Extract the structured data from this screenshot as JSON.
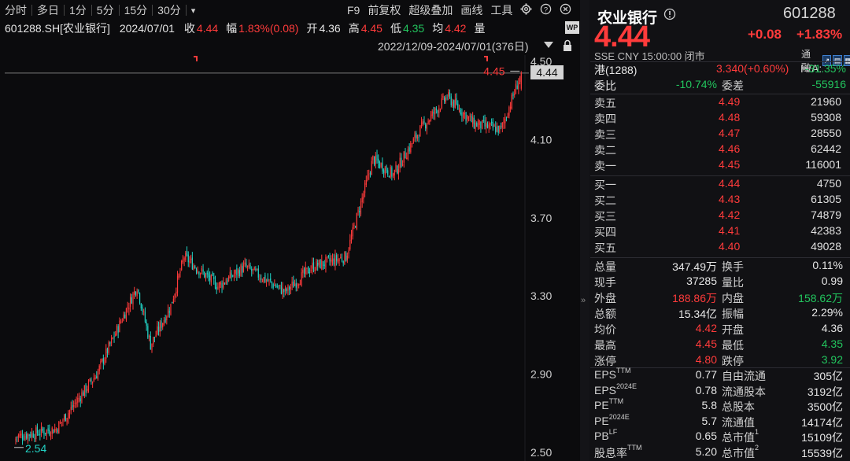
{
  "toolbar": {
    "periods": [
      "分时",
      "多日",
      "1分",
      "5分",
      "15分",
      "30分"
    ],
    "dropdown": "▾",
    "tools": [
      "F9",
      "前复权",
      "超级叠加",
      "画线",
      "工具"
    ],
    "icons": [
      "gear-icon",
      "help-icon",
      "close-icon",
      "chevron-right-icon"
    ]
  },
  "info": {
    "symbol": "601288.SH[农业银行]",
    "date": "2024/07/01",
    "close_label": "收",
    "close": "4.44",
    "amp_label": "幅",
    "amp": "1.83%(0.08)",
    "open_label": "开",
    "open": "4.36",
    "high_label": "高",
    "high": "4.45",
    "low_label": "低",
    "low": "4.35",
    "avg_label": "均",
    "avg": "4.42",
    "vol_label": "量"
  },
  "range": "2022/12/09-2024/07/01(376日)",
  "chart_data": {
    "type": "candlestick",
    "y_ticks": [
      "4.50",
      "4.10",
      "3.70",
      "3.30",
      "2.90",
      "2.50"
    ],
    "ylim": [
      2.5,
      4.5
    ],
    "current_price": "4.44",
    "max_marker": "4.45",
    "min_marker": "2.54",
    "key_points": [
      {
        "date": "2022/12/09",
        "price": 2.58
      },
      {
        "idx": 30,
        "price": 2.62
      },
      {
        "idx": 60,
        "price": 2.9
      },
      {
        "idx": 90,
        "price": 3.35
      },
      {
        "idx": 100,
        "price": 3.05
      },
      {
        "idx": 115,
        "price": 3.25
      },
      {
        "idx": 125,
        "price": 3.5
      },
      {
        "idx": 150,
        "price": 3.35
      },
      {
        "idx": 170,
        "price": 3.45
      },
      {
        "idx": 200,
        "price": 3.32
      },
      {
        "idx": 220,
        "price": 3.45
      },
      {
        "idx": 245,
        "price": 3.5
      },
      {
        "idx": 265,
        "price": 4.0
      },
      {
        "idx": 280,
        "price": 3.92
      },
      {
        "idx": 300,
        "price": 4.15
      },
      {
        "idx": 320,
        "price": 4.32
      },
      {
        "idx": 340,
        "price": 4.18
      },
      {
        "idx": 360,
        "price": 4.15
      },
      {
        "date": "2024/07/01",
        "price": 4.44
      }
    ]
  },
  "panel": {
    "name": "农业银行",
    "code": "601288",
    "price": "4.44",
    "change": "+0.08",
    "change_pct": "+1.83%",
    "meta": "SSE  CNY  15:00:00  闭市",
    "flag_text": "通  融",
    "hk_label": "港(1288)",
    "hk_price": "3.340(+0.60%)",
    "ha_label": "H/A:",
    "ha_value": "-31.35%",
    "weibi_label": "委比",
    "weibi": "-10.74%",
    "weicha_label": "委差",
    "weicha": "-55916",
    "asks": [
      {
        "label": "卖五",
        "price": "4.49",
        "vol": "21960"
      },
      {
        "label": "卖四",
        "price": "4.48",
        "vol": "59308"
      },
      {
        "label": "卖三",
        "price": "4.47",
        "vol": "28550"
      },
      {
        "label": "卖二",
        "price": "4.46",
        "vol": "62442"
      },
      {
        "label": "卖一",
        "price": "4.45",
        "vol": "116001"
      }
    ],
    "bids": [
      {
        "label": "买一",
        "price": "4.44",
        "vol": "4750"
      },
      {
        "label": "买二",
        "price": "4.43",
        "vol": "61305"
      },
      {
        "label": "买三",
        "price": "4.42",
        "vol": "74879"
      },
      {
        "label": "买四",
        "price": "4.41",
        "vol": "42383"
      },
      {
        "label": "买五",
        "price": "4.40",
        "vol": "49028"
      }
    ],
    "stats": [
      {
        "l1": "总量",
        "v1": "347.49万",
        "c1": "white",
        "l2": "换手",
        "v2": "0.11%",
        "c2": "white"
      },
      {
        "l1": "现手",
        "v1": "37285",
        "c1": "white",
        "l2": "量比",
        "v2": "0.99",
        "c2": "white"
      },
      {
        "l1": "外盘",
        "v1": "188.86万",
        "c1": "red",
        "l2": "内盘",
        "v2": "158.62万",
        "c2": "green"
      },
      {
        "l1": "总额",
        "v1": "15.34亿",
        "c1": "white",
        "l2": "振幅",
        "v2": "2.29%",
        "c2": "white"
      },
      {
        "l1": "均价",
        "v1": "4.42",
        "c1": "red",
        "l2": "开盘",
        "v2": "4.36",
        "c2": "white"
      },
      {
        "l1": "最高",
        "v1": "4.45",
        "c1": "red",
        "l2": "最低",
        "v2": "4.35",
        "c2": "green"
      },
      {
        "l1": "涨停",
        "v1": "4.80",
        "c1": "red",
        "l2": "跌停",
        "v2": "3.92",
        "c2": "green"
      }
    ],
    "fundamentals": [
      {
        "l1": "EPS",
        "s1": "TTM",
        "v1": "0.77",
        "l2": "自由流通",
        "s2": "",
        "v2": "305亿"
      },
      {
        "l1": "EPS",
        "s1": "2024E",
        "v1": "0.78",
        "l2": "流通股本",
        "s2": "",
        "v2": "3192亿"
      },
      {
        "l1": "PE",
        "s1": "TTM",
        "v1": "5.8",
        "l2": "总股本",
        "s2": "",
        "v2": "3500亿"
      },
      {
        "l1": "PE",
        "s1": "2024E",
        "v1": "5.7",
        "l2": "流通值",
        "s2": "",
        "v2": "14174亿"
      },
      {
        "l1": "PB",
        "s1": "LF",
        "v1": "0.65",
        "l2": "总市值",
        "s2": "1",
        "v2": "15109亿"
      },
      {
        "l1": "股息率",
        "s1": "TTM",
        "v1": "5.20",
        "l2": "总市值",
        "s2": "2",
        "v2": "15539亿"
      }
    ]
  },
  "colors": {
    "up": "#ff3b3b",
    "down": "#22d3c5",
    "text": "#d6d6d6",
    "bg": "#0d0d0f"
  }
}
